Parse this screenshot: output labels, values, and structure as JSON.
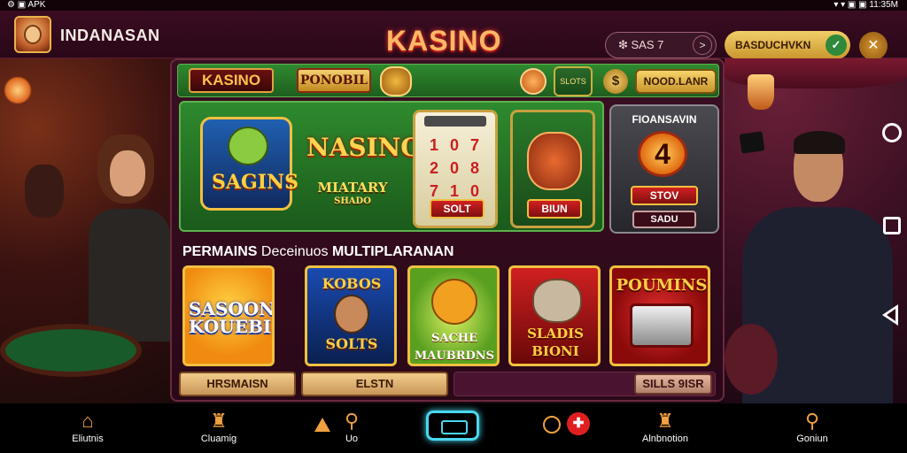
{
  "status_bar": {
    "left": "⚙ ▣ APK",
    "right": "▾ ▾ ▣ ▣ 11:35M"
  },
  "header": {
    "app_name": "INDANASAN",
    "brand": "KASINO",
    "search_text": "❇ SAS 7",
    "gold_pill_label": "BASDUCHVKN",
    "icons": [
      "app-logo",
      "search-icon",
      "chevron-right-icon",
      "check-icon",
      "close-icon"
    ]
  },
  "top_bar": {
    "kasino_label": "KASINO",
    "ponobil_label": "PONOBIL",
    "trophy_label": "SLOTS",
    "coin_symbol": "$",
    "gold_button_label": "NOOD.LANR"
  },
  "featured": {
    "logo_text": "SAGINS",
    "title": "NASINO",
    "subtitle": "MIATARY",
    "subtitle_small": "SHADO",
    "slot_one": {
      "top": "",
      "digits": "1 0 7\n2 0 8\n7 1 0",
      "button": "SOLT"
    },
    "slot_two": {
      "button": "BIUN"
    },
    "prize": {
      "title": "FIOANSAVIN",
      "number": "4",
      "button": "STOV",
      "button2": "SADU"
    }
  },
  "section_title_bold": "PERMAINS",
  "section_title_thin": "Deceinuos",
  "section_title_end": "MULTIPLARANAN",
  "games": [
    {
      "label": "SASOON KOUEBI",
      "label2": ""
    },
    {
      "label": "KOBOS",
      "label2": "SOLTS"
    },
    {
      "label": "SACHE MAUBRDNS",
      "label2": ""
    },
    {
      "label": "SLADIS BIONI",
      "label2": ""
    },
    {
      "label": "POUMINS",
      "label2": ""
    }
  ],
  "bottom_buttons": {
    "left": "HRSMAISN",
    "middle": "ELSTN",
    "right": "SILLS 9ISR"
  },
  "bottom_nav": [
    {
      "label": "Eliutnis",
      "icon": "home-icon"
    },
    {
      "label": "Cluamig",
      "icon": "castle-icon"
    },
    {
      "label": "Uo",
      "icon": "search-icon"
    },
    {
      "label": "Alnbnotion",
      "icon": "tower-icon"
    },
    {
      "label": "Goniun",
      "icon": "search-icon"
    }
  ],
  "colors": {
    "background": "#1a0712",
    "panel_green": "#2e8a2e",
    "gold": "#f0c040",
    "accent_red": "#d02020",
    "nav_center_glow": "#4ad8f0"
  }
}
